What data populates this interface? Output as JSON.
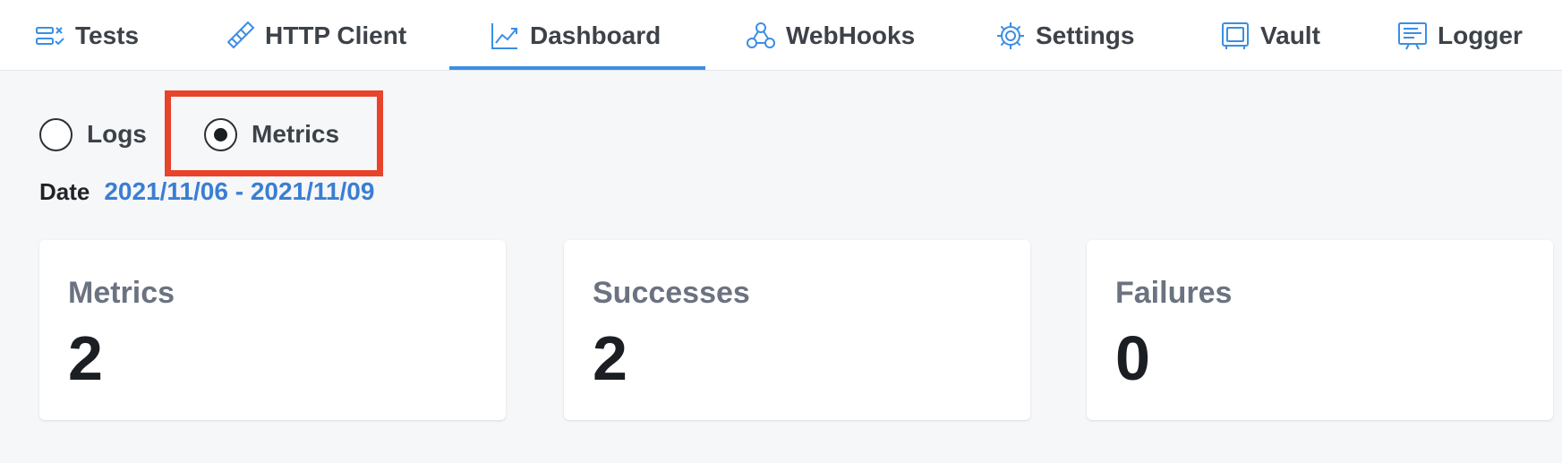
{
  "nav": {
    "tabs": [
      {
        "label": "Tests",
        "icon": "tests-icon"
      },
      {
        "label": "HTTP Client",
        "icon": "http-client-icon"
      },
      {
        "label": "Dashboard",
        "icon": "dashboard-chart-icon",
        "active": true
      },
      {
        "label": "WebHooks",
        "icon": "webhooks-icon"
      },
      {
        "label": "Settings",
        "icon": "gear-icon"
      },
      {
        "label": "Vault",
        "icon": "vault-icon"
      },
      {
        "label": "Logger",
        "icon": "logger-icon"
      }
    ]
  },
  "view_mode": {
    "options": [
      {
        "label": "Logs",
        "selected": false
      },
      {
        "label": "Metrics",
        "selected": true
      }
    ]
  },
  "date": {
    "label": "Date",
    "value": "2021/11/06 - 2021/11/09"
  },
  "stats": [
    {
      "title": "Metrics",
      "value": "2"
    },
    {
      "title": "Successes",
      "value": "2"
    },
    {
      "title": "Failures",
      "value": "0"
    }
  ],
  "colors": {
    "accent": "#3b8ee5",
    "date_link": "#3a7ed3",
    "highlight": "#e8432b",
    "card_title": "#6b7280"
  }
}
